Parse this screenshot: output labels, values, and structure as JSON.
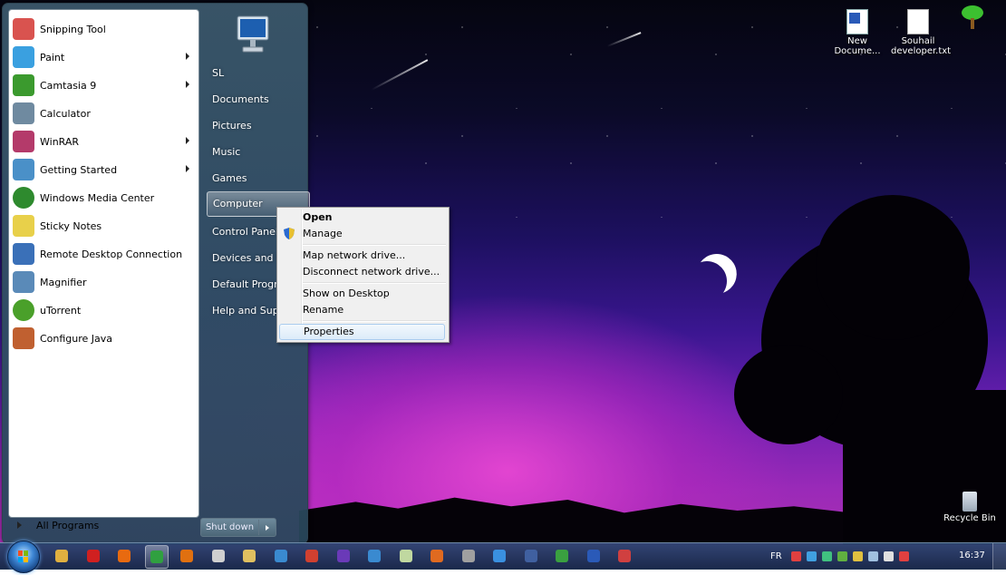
{
  "desktop": {
    "icons": [
      {
        "label": "New Docume...",
        "icon": "word-document-icon"
      },
      {
        "label": "Souhail developer.txt",
        "icon": "text-file-icon"
      },
      {
        "label": "",
        "icon": "tree-shortcut-icon"
      }
    ],
    "recycle_bin": {
      "label": "Recycle Bin",
      "icon": "recycle-bin-icon"
    }
  },
  "start_menu": {
    "programs": [
      {
        "label": "Snipping Tool",
        "icon": "scissors-icon",
        "submenu": false,
        "color": "#d9534f"
      },
      {
        "label": "Paint",
        "icon": "paint-palette-icon",
        "submenu": true,
        "color": "#3aa0e0"
      },
      {
        "label": "Camtasia 9",
        "icon": "camtasia-icon",
        "submenu": true,
        "color": "#3b9a2e"
      },
      {
        "label": "Calculator",
        "icon": "calculator-icon",
        "submenu": false,
        "color": "#6f8aa0"
      },
      {
        "label": "WinRAR",
        "icon": "winrar-icon",
        "submenu": true,
        "color": "#b43a6a"
      },
      {
        "label": "Getting Started",
        "icon": "getting-started-icon",
        "submenu": true,
        "color": "#4a90c8"
      },
      {
        "label": "Windows Media Center",
        "icon": "media-center-icon",
        "submenu": false,
        "color": "#2e8a2e"
      },
      {
        "label": "Sticky Notes",
        "icon": "sticky-notes-icon",
        "submenu": false,
        "color": "#e8d04a"
      },
      {
        "label": "Remote Desktop Connection",
        "icon": "remote-desktop-icon",
        "submenu": false,
        "color": "#3a70b8"
      },
      {
        "label": "Magnifier",
        "icon": "magnifier-icon",
        "submenu": false,
        "color": "#5a8ab8"
      },
      {
        "label": "uTorrent",
        "icon": "utorrent-icon",
        "submenu": false,
        "color": "#4aa02a"
      },
      {
        "label": "Configure Java",
        "icon": "java-icon",
        "submenu": false,
        "color": "#c06030"
      }
    ],
    "all_programs": "All Programs",
    "right_items": [
      {
        "label": "SL"
      },
      {
        "label": "Documents"
      },
      {
        "label": "Pictures"
      },
      {
        "label": "Music"
      },
      {
        "label": "Games"
      },
      {
        "label": "Computer"
      },
      {
        "label": "Control Panel"
      },
      {
        "label": "Devices and Printers"
      },
      {
        "label": "Default Programs"
      },
      {
        "label": "Help and Support"
      }
    ],
    "shutdown": "Shut down"
  },
  "context_menu": {
    "items": [
      {
        "label": "Open"
      },
      {
        "label": "Manage"
      },
      {
        "label": "Map network drive..."
      },
      {
        "label": "Disconnect network drive..."
      },
      {
        "label": "Show on Desktop"
      },
      {
        "label": "Rename"
      },
      {
        "label": "Properties"
      }
    ]
  },
  "taskbar": {
    "apps": [
      {
        "icon": "explorer-icon",
        "color": "#e0b040"
      },
      {
        "icon": "opera-icon",
        "color": "#d02020"
      },
      {
        "icon": "firefox-icon",
        "color": "#e86a10"
      },
      {
        "icon": "chrome-icon",
        "color": "#30a040"
      },
      {
        "icon": "media-player-icon",
        "color": "#e07010"
      },
      {
        "icon": "unity-icon",
        "color": "#d0d0d0"
      },
      {
        "icon": "folder-icon",
        "color": "#e0c060"
      },
      {
        "icon": "app-icon",
        "color": "#3a8ad0"
      },
      {
        "icon": "app-icon",
        "color": "#d04030"
      },
      {
        "icon": "visual-studio-icon",
        "color": "#6a3ab8"
      },
      {
        "icon": "app-icon",
        "color": "#3a8ad0"
      },
      {
        "icon": "notepad-icon",
        "color": "#c0d8a0"
      },
      {
        "icon": "xampp-icon",
        "color": "#e06a20"
      },
      {
        "icon": "app-icon",
        "color": "#a0a0a0"
      },
      {
        "icon": "internet-explorer-icon",
        "color": "#3a90e0"
      },
      {
        "icon": "save-icon",
        "color": "#4060a0"
      },
      {
        "icon": "app-icon",
        "color": "#3aa040"
      },
      {
        "icon": "word-icon",
        "color": "#2a5ab8"
      },
      {
        "icon": "snipping-tool-icon",
        "color": "#d04040"
      }
    ],
    "tray": {
      "language": "FR",
      "icons": [
        {
          "icon": "tray-icon",
          "color": "#e04040"
        },
        {
          "icon": "tray-icon",
          "color": "#40a0e0"
        },
        {
          "icon": "tray-icon",
          "color": "#40c080"
        },
        {
          "icon": "tray-icon",
          "color": "#60b040"
        },
        {
          "icon": "tray-icon",
          "color": "#e0c040"
        },
        {
          "icon": "network-icon",
          "color": "#a0c0e0"
        },
        {
          "icon": "volume-icon",
          "color": "#e0e0e0"
        },
        {
          "icon": "flag-icon",
          "color": "#e04040"
        }
      ],
      "clock": "16:37"
    }
  }
}
